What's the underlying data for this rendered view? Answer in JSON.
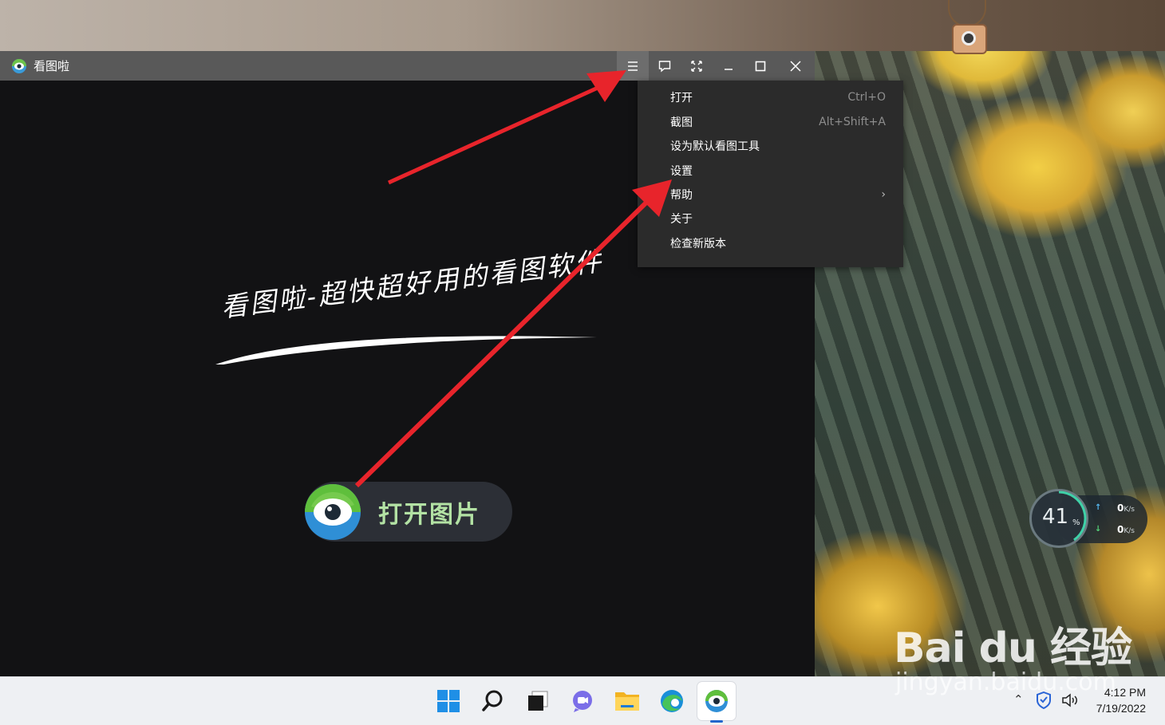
{
  "window": {
    "title": "看图啦",
    "controls": [
      "menu-icon",
      "feedback-icon",
      "fullscreen-icon",
      "minimize-icon",
      "maximize-icon",
      "close-icon"
    ]
  },
  "main": {
    "slogan": "看图啦-超快超好用的看图软件",
    "open_button_label": "打开图片"
  },
  "menu": {
    "items": [
      {
        "label": "打开",
        "shortcut": "Ctrl+O"
      },
      {
        "label": "截图",
        "shortcut": "Alt+Shift+A"
      },
      {
        "label": "设为默认看图工具",
        "shortcut": ""
      },
      {
        "label": "设置",
        "shortcut": ""
      },
      {
        "label": "帮助",
        "shortcut": "",
        "submenu": true
      },
      {
        "label": "关于",
        "shortcut": ""
      },
      {
        "label": "检查新版本",
        "shortcut": ""
      }
    ]
  },
  "widget": {
    "percent": "41",
    "percent_sign": "%",
    "upload": "0",
    "download": "0",
    "unit": "K/s",
    "up_arrow": "↑",
    "down_arrow": "↓"
  },
  "watermark": {
    "brand": "Bai du 经验",
    "url": "jingyan.baidu.com"
  },
  "taskbar": {
    "apps": [
      "start-icon",
      "search-icon",
      "task-view-icon",
      "chat-icon",
      "file-explorer-icon",
      "edge-icon",
      "kantula-icon"
    ],
    "clock_time": "4:12 PM",
    "clock_date": "7/19/2022"
  },
  "colors": {
    "titlebar": "#595959",
    "canvas": "#121214",
    "menu_bg": "#2b2b2b",
    "annotation_red": "#e8242b",
    "button_label": "#b3e2a4"
  }
}
